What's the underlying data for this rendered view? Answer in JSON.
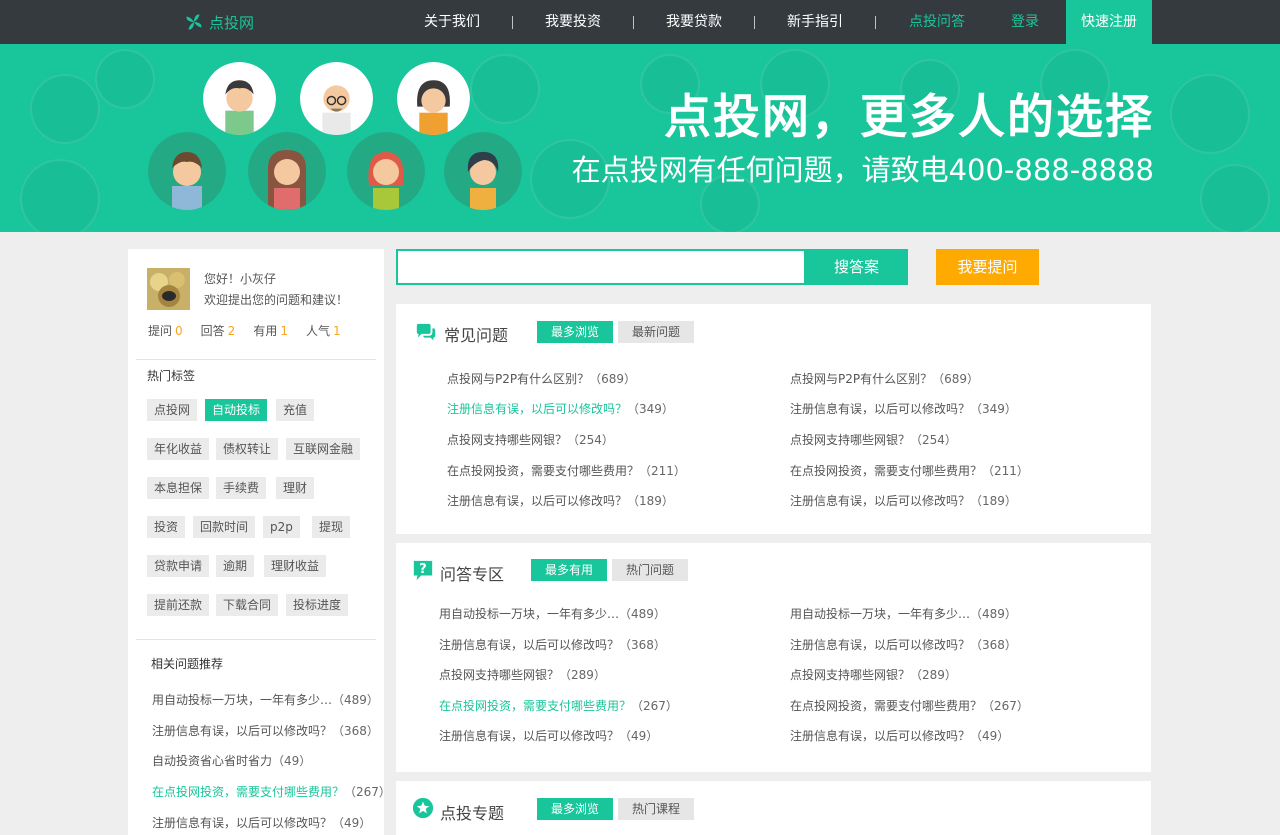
{
  "brand": {
    "name": "点投网"
  },
  "nav": {
    "items": [
      "关于我们",
      "我要投资",
      "我要贷款",
      "新手指引",
      "点投问答"
    ],
    "login": "登录",
    "register": "快速注册"
  },
  "banner": {
    "title": "点投网，更多人的选择",
    "subtitle": "在点投网有任何问题，请致电400-888-8888"
  },
  "profile": {
    "greeting": "您好！小灰仔",
    "prompt": "欢迎提出您的问题和建议！",
    "stats": [
      {
        "label": "提问",
        "value": "0"
      },
      {
        "label": "回答",
        "value": "2"
      },
      {
        "label": "有用",
        "value": "1"
      },
      {
        "label": "人气",
        "value": "1"
      }
    ]
  },
  "hot_tags": {
    "heading": "热门标签",
    "tags": [
      "点投网",
      "自动投标",
      "充值",
      "年化收益",
      "债权转让",
      "互联网金融",
      "本息担保",
      "手续费",
      "理财",
      "投资",
      "回款时间",
      "p2p",
      "提现",
      "贷款申请",
      "逾期",
      "理财收益",
      "提前还款",
      "下载合同",
      "投标进度"
    ],
    "active": "自动投标"
  },
  "related": {
    "heading": "相关问题推荐",
    "items": [
      {
        "text": "用自动投标一万块，一年有多少…",
        "count": "（489）"
      },
      {
        "text": "注册信息有误，以后可以修改吗？",
        "count": "（368）"
      },
      {
        "text": "自动投资省心省时省力",
        "count": "（49）"
      },
      {
        "text": "在点投网投资，需要支付哪些费用？",
        "count": "（267）"
      },
      {
        "text": "注册信息有误，以后可以修改吗？",
        "count": "（49）"
      }
    ]
  },
  "search": {
    "placeholder": "",
    "button": "搜答案",
    "ask": "我要提问"
  },
  "faq": {
    "title": "常见问题",
    "tabs": [
      "最多浏览",
      "最新问题"
    ],
    "left": [
      {
        "text": "点投网与P2P有什么区别？",
        "count": "（689）"
      },
      {
        "text": "注册信息有误，以后可以修改吗？",
        "count": "（349）"
      },
      {
        "text": "点投网支持哪些网银？",
        "count": "（254）"
      },
      {
        "text": "在点投网投资，需要支付哪些费用？",
        "count": "（211）"
      },
      {
        "text": "注册信息有误，以后可以修改吗？",
        "count": "（189）"
      }
    ],
    "right": [
      {
        "text": "点投网与P2P有什么区别？",
        "count": "（689）"
      },
      {
        "text": "注册信息有误，以后可以修改吗？",
        "count": "（349）"
      },
      {
        "text": "点投网支持哪些网银？",
        "count": "（254）"
      },
      {
        "text": "在点投网投资，需要支付哪些费用？",
        "count": "（211）"
      },
      {
        "text": "注册信息有误，以后可以修改吗？",
        "count": "（189）"
      }
    ]
  },
  "qa": {
    "title": "问答专区",
    "tabs": [
      "最多有用",
      "热门问题"
    ],
    "left": [
      {
        "text": "用自动投标一万块，一年有多少…",
        "count": "（489）"
      },
      {
        "text": "注册信息有误，以后可以修改吗？",
        "count": "（368）"
      },
      {
        "text": "点投网支持哪些网银？",
        "count": "（289）"
      },
      {
        "text": "在点投网投资，需要支付哪些费用？",
        "count": "（267）"
      },
      {
        "text": "注册信息有误，以后可以修改吗？",
        "count": "（49）"
      }
    ],
    "right": [
      {
        "text": "用自动投标一万块，一年有多少…",
        "count": "（489）"
      },
      {
        "text": "注册信息有误，以后可以修改吗？",
        "count": "（368）"
      },
      {
        "text": "点投网支持哪些网银？",
        "count": "（289）"
      },
      {
        "text": "在点投网投资，需要支付哪些费用？",
        "count": "（267）"
      },
      {
        "text": "注册信息有误，以后可以修改吗？",
        "count": "（49）"
      }
    ]
  },
  "topics": {
    "title": "点投专题",
    "tabs": [
      "最多浏览",
      "热门课程"
    ]
  },
  "colors": {
    "accent": "#19c59a",
    "nav_bg": "#353a3f",
    "orange": "#ffaa00",
    "stat_number": "#f5a623"
  }
}
